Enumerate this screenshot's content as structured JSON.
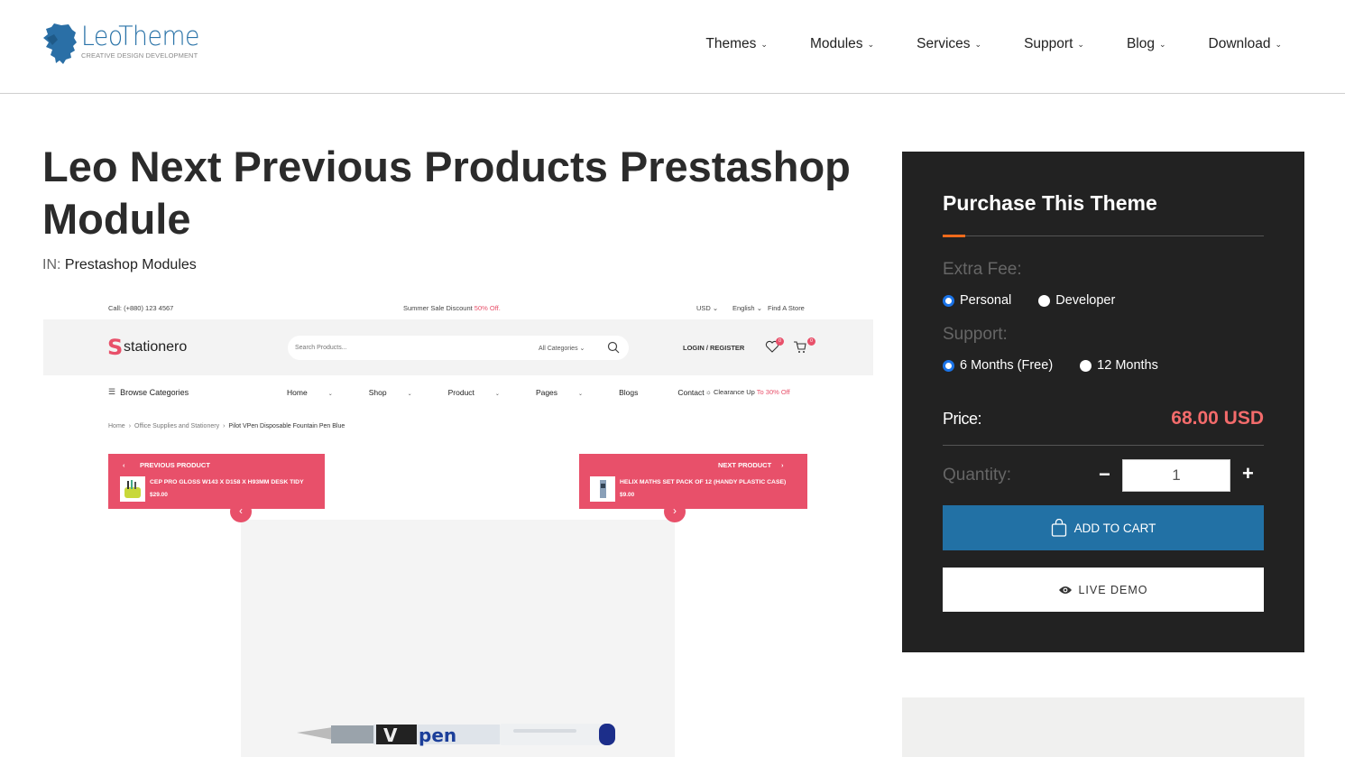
{
  "header": {
    "logo_name": "LeoTheme",
    "logo_tagline": "CREATIVE DESIGN DEVELOPMENT",
    "nav": [
      {
        "label": "Themes"
      },
      {
        "label": "Modules"
      },
      {
        "label": "Services"
      },
      {
        "label": "Support"
      },
      {
        "label": "Blog"
      },
      {
        "label": "Download"
      }
    ]
  },
  "page": {
    "title": "Leo Next Previous Products Prestashop Module",
    "category_prefix": "IN:",
    "category": "Prestashop Modules"
  },
  "preview": {
    "call": "Call: (+880) 123 4567",
    "sale_text": "Summer Sale Discount",
    "sale_highlight": "50% Off.",
    "currency": "USD",
    "language": "English",
    "find_store": "Find A Store",
    "store_name": "stationero",
    "search_placeholder": "Search Products...",
    "categories_select": "All Categories",
    "login": "LOGIN / REGISTER",
    "wishlist_count": "0",
    "cart_count": "0",
    "browse_categories": "Browse Categories",
    "menu": [
      {
        "label": "Home",
        "dropdown": true
      },
      {
        "label": "Shop",
        "dropdown": true
      },
      {
        "label": "Product",
        "dropdown": true
      },
      {
        "label": "Pages",
        "dropdown": true
      },
      {
        "label": "Blogs",
        "dropdown": false
      },
      {
        "label": "Contact",
        "dropdown": false
      }
    ],
    "clearance_text": "Clearance Up",
    "clearance_highlight": "To 30% Off",
    "breadcrumb": [
      "Home",
      "Office Supplies and Stationery",
      "Pilot VPen Disposable Fountain Pen Blue"
    ],
    "previous_product": {
      "label": "PREVIOUS PRODUCT",
      "title": "CEP PRO GLOSS W143 X D158 X H93MM DESK TIDY",
      "price": "$29.00"
    },
    "next_product": {
      "label": "NEXT PRODUCT",
      "title": "HELIX MATHS SET PACK OF 12 (HANDY PLASTIC CASE)",
      "price": "$9.00"
    },
    "accent_color": "#e8506a"
  },
  "purchase": {
    "title": "Purchase This Theme",
    "extra_fee_label": "Extra Fee:",
    "extra_fee_options": [
      {
        "label": "Personal",
        "checked": true
      },
      {
        "label": "Developer",
        "checked": false
      }
    ],
    "support_label": "Support:",
    "support_options": [
      {
        "label": "6 Months (Free)",
        "checked": true
      },
      {
        "label": "12 Months",
        "checked": false
      }
    ],
    "price_label": "Price:",
    "price": "68.00 USD",
    "quantity_label": "Quantity:",
    "quantity": "1",
    "minus": "−",
    "plus": "+",
    "add_to_cart": "ADD TO CART",
    "live_demo": "LIVE DEMO",
    "colors": {
      "panel": "#222222",
      "cart_button": "#2271a5",
      "price": "#f36b6b",
      "accent": "#f06a1b"
    }
  }
}
